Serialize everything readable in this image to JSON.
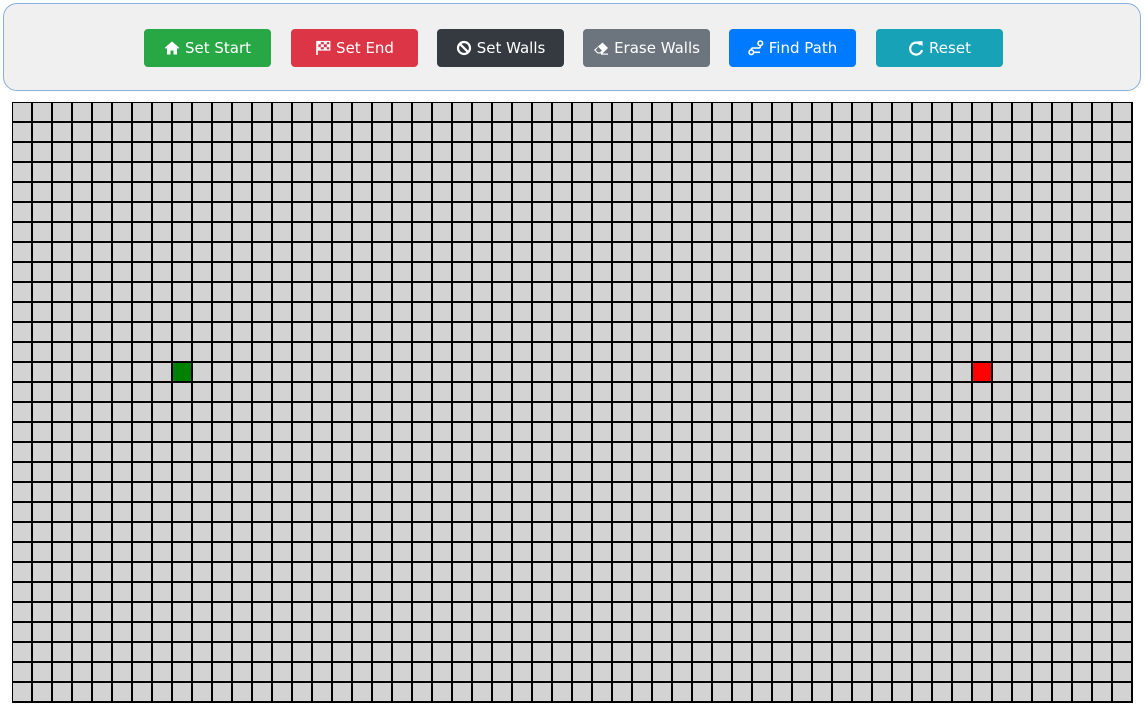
{
  "toolbar": {
    "buttons": [
      {
        "id": "set-start",
        "label": "Set Start",
        "icon": "home-icon",
        "color": "#28a745"
      },
      {
        "id": "set-end",
        "label": "Set End",
        "icon": "checkered-flag-icon",
        "color": "#dc3545"
      },
      {
        "id": "set-walls",
        "label": "Set Walls",
        "icon": "ban-icon",
        "color": "#343a40"
      },
      {
        "id": "erase-walls",
        "label": "Erase Walls",
        "icon": "eraser-icon",
        "color": "#6c757d"
      },
      {
        "id": "find-path",
        "label": "Find Path",
        "icon": "route-icon",
        "color": "#007bff"
      },
      {
        "id": "reset",
        "label": "Reset",
        "icon": "redo-icon",
        "color": "#17a2b8"
      }
    ]
  },
  "grid": {
    "rows": 30,
    "cols": 56,
    "cell_color": "#d3d3d3",
    "border_color": "#000000",
    "start": {
      "row": 13,
      "col": 8,
      "color": "#008000"
    },
    "end": {
      "row": 13,
      "col": 48,
      "color": "#ff0000"
    },
    "walls": []
  }
}
